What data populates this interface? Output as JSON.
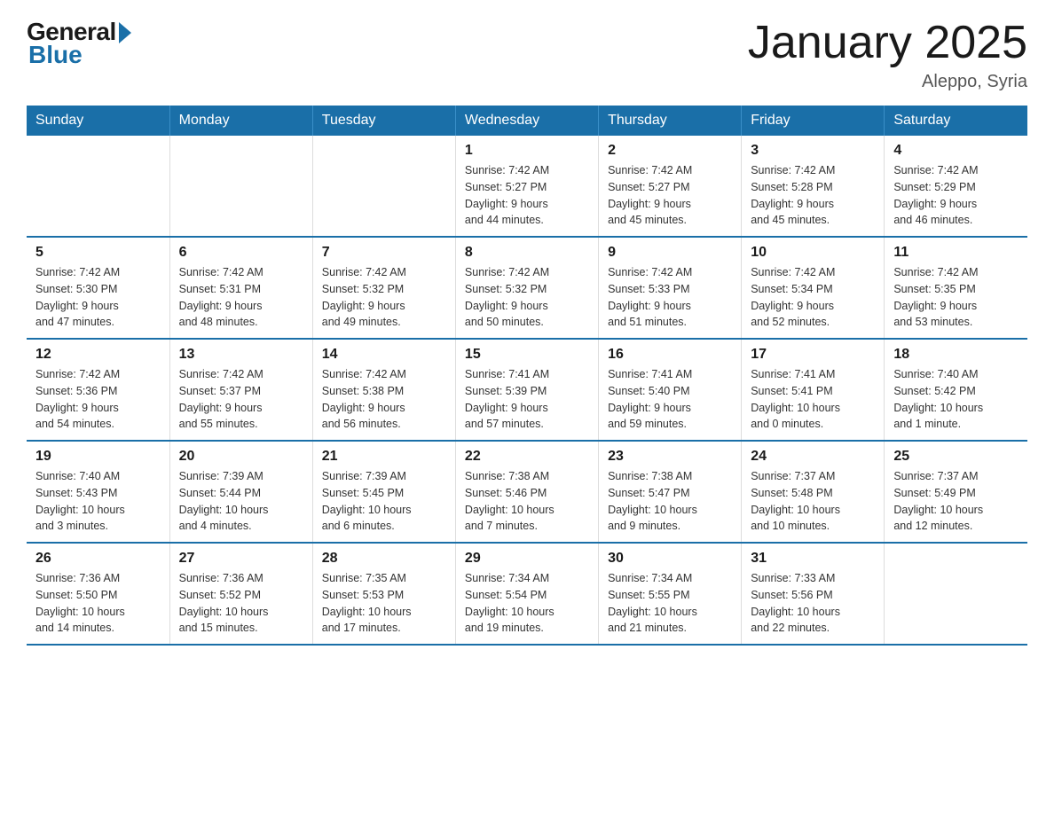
{
  "header": {
    "logo_general": "General",
    "logo_blue": "Blue",
    "title": "January 2025",
    "subtitle": "Aleppo, Syria"
  },
  "calendar": {
    "days_of_week": [
      "Sunday",
      "Monday",
      "Tuesday",
      "Wednesday",
      "Thursday",
      "Friday",
      "Saturday"
    ],
    "weeks": [
      [
        {
          "day": "",
          "info": ""
        },
        {
          "day": "",
          "info": ""
        },
        {
          "day": "",
          "info": ""
        },
        {
          "day": "1",
          "info": "Sunrise: 7:42 AM\nSunset: 5:27 PM\nDaylight: 9 hours\nand 44 minutes."
        },
        {
          "day": "2",
          "info": "Sunrise: 7:42 AM\nSunset: 5:27 PM\nDaylight: 9 hours\nand 45 minutes."
        },
        {
          "day": "3",
          "info": "Sunrise: 7:42 AM\nSunset: 5:28 PM\nDaylight: 9 hours\nand 45 minutes."
        },
        {
          "day": "4",
          "info": "Sunrise: 7:42 AM\nSunset: 5:29 PM\nDaylight: 9 hours\nand 46 minutes."
        }
      ],
      [
        {
          "day": "5",
          "info": "Sunrise: 7:42 AM\nSunset: 5:30 PM\nDaylight: 9 hours\nand 47 minutes."
        },
        {
          "day": "6",
          "info": "Sunrise: 7:42 AM\nSunset: 5:31 PM\nDaylight: 9 hours\nand 48 minutes."
        },
        {
          "day": "7",
          "info": "Sunrise: 7:42 AM\nSunset: 5:32 PM\nDaylight: 9 hours\nand 49 minutes."
        },
        {
          "day": "8",
          "info": "Sunrise: 7:42 AM\nSunset: 5:32 PM\nDaylight: 9 hours\nand 50 minutes."
        },
        {
          "day": "9",
          "info": "Sunrise: 7:42 AM\nSunset: 5:33 PM\nDaylight: 9 hours\nand 51 minutes."
        },
        {
          "day": "10",
          "info": "Sunrise: 7:42 AM\nSunset: 5:34 PM\nDaylight: 9 hours\nand 52 minutes."
        },
        {
          "day": "11",
          "info": "Sunrise: 7:42 AM\nSunset: 5:35 PM\nDaylight: 9 hours\nand 53 minutes."
        }
      ],
      [
        {
          "day": "12",
          "info": "Sunrise: 7:42 AM\nSunset: 5:36 PM\nDaylight: 9 hours\nand 54 minutes."
        },
        {
          "day": "13",
          "info": "Sunrise: 7:42 AM\nSunset: 5:37 PM\nDaylight: 9 hours\nand 55 minutes."
        },
        {
          "day": "14",
          "info": "Sunrise: 7:42 AM\nSunset: 5:38 PM\nDaylight: 9 hours\nand 56 minutes."
        },
        {
          "day": "15",
          "info": "Sunrise: 7:41 AM\nSunset: 5:39 PM\nDaylight: 9 hours\nand 57 minutes."
        },
        {
          "day": "16",
          "info": "Sunrise: 7:41 AM\nSunset: 5:40 PM\nDaylight: 9 hours\nand 59 minutes."
        },
        {
          "day": "17",
          "info": "Sunrise: 7:41 AM\nSunset: 5:41 PM\nDaylight: 10 hours\nand 0 minutes."
        },
        {
          "day": "18",
          "info": "Sunrise: 7:40 AM\nSunset: 5:42 PM\nDaylight: 10 hours\nand 1 minute."
        }
      ],
      [
        {
          "day": "19",
          "info": "Sunrise: 7:40 AM\nSunset: 5:43 PM\nDaylight: 10 hours\nand 3 minutes."
        },
        {
          "day": "20",
          "info": "Sunrise: 7:39 AM\nSunset: 5:44 PM\nDaylight: 10 hours\nand 4 minutes."
        },
        {
          "day": "21",
          "info": "Sunrise: 7:39 AM\nSunset: 5:45 PM\nDaylight: 10 hours\nand 6 minutes."
        },
        {
          "day": "22",
          "info": "Sunrise: 7:38 AM\nSunset: 5:46 PM\nDaylight: 10 hours\nand 7 minutes."
        },
        {
          "day": "23",
          "info": "Sunrise: 7:38 AM\nSunset: 5:47 PM\nDaylight: 10 hours\nand 9 minutes."
        },
        {
          "day": "24",
          "info": "Sunrise: 7:37 AM\nSunset: 5:48 PM\nDaylight: 10 hours\nand 10 minutes."
        },
        {
          "day": "25",
          "info": "Sunrise: 7:37 AM\nSunset: 5:49 PM\nDaylight: 10 hours\nand 12 minutes."
        }
      ],
      [
        {
          "day": "26",
          "info": "Sunrise: 7:36 AM\nSunset: 5:50 PM\nDaylight: 10 hours\nand 14 minutes."
        },
        {
          "day": "27",
          "info": "Sunrise: 7:36 AM\nSunset: 5:52 PM\nDaylight: 10 hours\nand 15 minutes."
        },
        {
          "day": "28",
          "info": "Sunrise: 7:35 AM\nSunset: 5:53 PM\nDaylight: 10 hours\nand 17 minutes."
        },
        {
          "day": "29",
          "info": "Sunrise: 7:34 AM\nSunset: 5:54 PM\nDaylight: 10 hours\nand 19 minutes."
        },
        {
          "day": "30",
          "info": "Sunrise: 7:34 AM\nSunset: 5:55 PM\nDaylight: 10 hours\nand 21 minutes."
        },
        {
          "day": "31",
          "info": "Sunrise: 7:33 AM\nSunset: 5:56 PM\nDaylight: 10 hours\nand 22 minutes."
        },
        {
          "day": "",
          "info": ""
        }
      ]
    ]
  }
}
